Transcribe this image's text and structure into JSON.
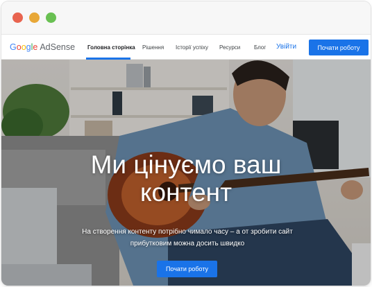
{
  "window": {
    "controls": [
      "close",
      "minimize",
      "maximize"
    ]
  },
  "nav": {
    "logo_google_letters": [
      "G",
      "o",
      "o",
      "g",
      "l",
      "e"
    ],
    "logo_product": "AdSense",
    "items": [
      {
        "label": "Головна сторінка",
        "active": true
      },
      {
        "label": "Рішення",
        "active": false
      },
      {
        "label": "Історії успіху",
        "active": false
      },
      {
        "label": "Ресурси",
        "active": false
      },
      {
        "label": "Блог",
        "active": false
      }
    ],
    "signin_label": "Увійти",
    "cta_label": "Почати роботу"
  },
  "hero": {
    "title_line1": "Ми цінуємо ваш",
    "title_line2": "контент",
    "subtitle_line1": "На створення контенту потрібно чимало часу – а от зробити сайт",
    "subtitle_line2": "прибутковим можна досить швидко",
    "cta_label": "Почати роботу",
    "image_description_icon": "man-playing-guitar-photo"
  },
  "colors": {
    "accent": "#1a73e8",
    "dot_red": "#e8644f",
    "dot_yellow": "#e8a838",
    "dot_green": "#69c052"
  }
}
